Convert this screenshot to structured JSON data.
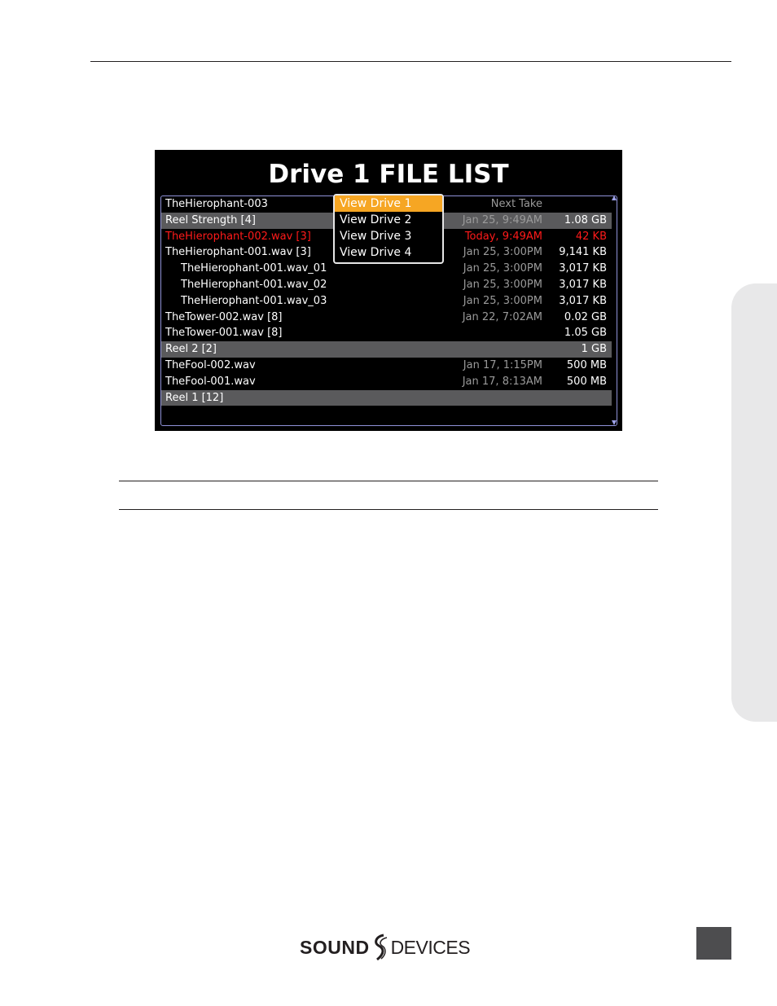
{
  "screen": {
    "title": "Drive 1 FILE LIST",
    "rows": [
      {
        "name": "TheHierophant-003",
        "date": "Next Take",
        "size": "",
        "style": "normal"
      },
      {
        "name": "Reel Strength [4]",
        "date": "Jan 25, 9:49AM",
        "size": "1.08 GB",
        "style": "reel"
      },
      {
        "name": "TheHierophant-002.wav [3]",
        "date": "Today, 9:49AM",
        "size": "42 KB",
        "style": "red"
      },
      {
        "name": "TheHierophant-001.wav [3]",
        "date": "Jan 25, 3:00PM",
        "size": "9,141 KB",
        "style": "normal"
      },
      {
        "name": "TheHierophant-001.wav_01",
        "date": "Jan 25, 3:00PM",
        "size": "3,017 KB",
        "style": "indent"
      },
      {
        "name": "TheHierophant-001.wav_02",
        "date": "Jan 25, 3:00PM",
        "size": "3,017 KB",
        "style": "indent"
      },
      {
        "name": "TheHierophant-001.wav_03",
        "date": "Jan 25, 3:00PM",
        "size": "3,017 KB",
        "style": "indent"
      },
      {
        "name": "TheTower-002.wav [8]",
        "date": "Jan 22, 7:02AM",
        "size": "0.02 GB",
        "style": "normal"
      },
      {
        "name": "TheTower-001.wav [8]",
        "date": "",
        "size": "1.05 GB",
        "style": "normal"
      },
      {
        "name": "Reel 2 [2]",
        "date": "",
        "size": "1 GB",
        "style": "reel"
      },
      {
        "name": "TheFool-002.wav",
        "date": "Jan 17, 1:15PM",
        "size": "500 MB",
        "style": "normal"
      },
      {
        "name": "TheFool-001.wav",
        "date": "Jan 17, 8:13AM",
        "size": "500 MB",
        "style": "normal"
      },
      {
        "name": "Reel 1 [12]",
        "date": "",
        "size": "",
        "style": "reel"
      }
    ],
    "dropdown": {
      "items": [
        "View Drive 1",
        "View Drive 2",
        "View Drive 3",
        "View Drive 4"
      ],
      "selected_index": 0
    }
  },
  "footer": {
    "logo_left": "SOUND",
    "logo_right": "DEVICES"
  },
  "colors": {
    "accent": "#f6a623",
    "reel_row": "#5a5a5c",
    "error_red": "#ff1a1a",
    "frame_border": "#8f92d8"
  }
}
